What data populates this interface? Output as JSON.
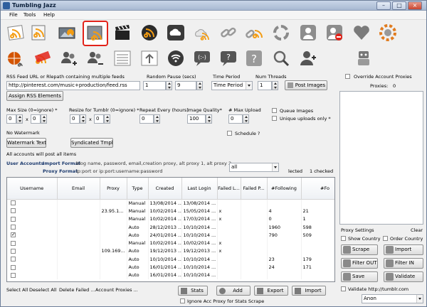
{
  "window": {
    "title": "Tumbling Jazz"
  },
  "menu": [
    "File",
    "Tools",
    "Help"
  ],
  "colors": {
    "accent": "#e2231a",
    "rss": "#f39c12",
    "dark": "#3a3a3a"
  },
  "toolbar_row1": [
    "rss-feed-icon",
    "rss-feed-icon",
    "image-rss-icon",
    "rss-image-selected-icon",
    "clapperboard-icon",
    "rss-circle-icon",
    "cloud-rss-icon",
    "cloud-rss-icon",
    "link-icon",
    "rss-link-icon",
    "refresh-circle-icon",
    "user-portrait-icon",
    "user-remove-icon",
    "heart-icon",
    "rss-settings-icon"
  ],
  "toolbar_row2": [
    "globe-rss-icon",
    "rss-cancel-icon",
    "add-users-icon",
    "users-remove-icon",
    "list-icon",
    "upload-icon",
    "wifi-rss-icon",
    "chat-icon",
    "help-chat-icon",
    "help-icon",
    "magnifier-icon",
    "add-person-icon",
    "robot-icon"
  ],
  "form": {
    "rss_label": "RSS Feed URL or Rlepath containing multiple feeds",
    "rss_value": "http://pinterest.com/music+production/feed.rss",
    "pause_label": "Random Pause (secs)",
    "pause_min": "1",
    "pause_max": "9",
    "period_label": "Time Period",
    "period_value": "Time Period",
    "threads_label": "Num Threads",
    "threads_value": "1",
    "post_images": "Post Images",
    "assign_rss": "Assign RSS Elements",
    "maxsize_label": "Max Size (0=ignore) *",
    "maxsize_w": "0",
    "maxsize_x": "x",
    "maxsize_h": "0",
    "resize_label": "Resize for Tumblr (0=ignore) *",
    "resize_w": "0",
    "resize_x": "x",
    "resize_h": "0",
    "repeat_label": "Repeat Every (hours)",
    "repeat_value": "0",
    "quality_label": "Image Quality*",
    "quality_value": "100",
    "maxupload_label": "# Max Upload",
    "maxupload_value": "0",
    "queue_images": "Queue Images",
    "unique_uploads": "Unique uploads only *",
    "schedule": "Schedule ?",
    "no_watermark": "No Watermark",
    "watermark_btn": "Watermark Text",
    "syndicated_btn": "Syndicated Tmpl",
    "all_accounts": "All accounts will post all items",
    "user_accounts": "User Accounts",
    "import_format_label": "Import Format",
    "import_format_value": "blog name, password, email,creation proxy, alt proxy 1, alt proxy 2, ...",
    "proxy_format_label": "Proxy Format",
    "proxy_format_value": "ip:port  or  ip:port:username:password",
    "filter_value": "all",
    "selected": "lected",
    "checked": "1 checked"
  },
  "grid": {
    "columns": [
      "Username",
      "Email",
      "Proxy",
      "Type",
      "Created",
      "Last Login",
      "Failed L...",
      "Failed P...",
      "#Following",
      "#Fo"
    ],
    "rows": [
      {
        "checked": false,
        "cells": [
          "",
          "",
          "",
          "Manual",
          "13/08/2014 ...",
          "13/08/2014 ...",
          "",
          "",
          "",
          ""
        ]
      },
      {
        "checked": false,
        "cells": [
          "",
          "",
          "23.95.1...",
          "Manual",
          "10/02/2014 ...",
          "15/05/2014 ...",
          "x",
          "",
          "4",
          "21"
        ]
      },
      {
        "checked": false,
        "cells": [
          "",
          "",
          "",
          "Manual",
          "10/02/2014 ...",
          "17/03/2014 ...",
          "x",
          "",
          "0",
          "1"
        ]
      },
      {
        "checked": false,
        "cells": [
          "",
          "",
          "",
          "Auto",
          "28/12/2013 ...",
          "10/10/2014 ...",
          "",
          "",
          "1960",
          "598"
        ]
      },
      {
        "checked": true,
        "cells": [
          "",
          "",
          "",
          "Auto",
          "24/01/2014 ...",
          "10/10/2014 ...",
          "",
          "",
          "790",
          "509"
        ]
      },
      {
        "checked": false,
        "cells": [
          "",
          "",
          "",
          "Manual",
          "10/02/2014 ...",
          "10/02/2014 ...",
          "x",
          "",
          "",
          ""
        ]
      },
      {
        "checked": false,
        "cells": [
          "",
          "",
          "109.169...",
          "Auto",
          "19/12/2013 ...",
          "19/12/2013 ...",
          "x",
          "",
          "",
          ""
        ]
      },
      {
        "checked": false,
        "cells": [
          "",
          "",
          "",
          "Auto",
          "10/10/2014 ...",
          "10/10/2014 ...",
          "",
          "",
          "23",
          "179"
        ]
      },
      {
        "checked": false,
        "cells": [
          "",
          "",
          "",
          "Auto",
          "16/01/2014 ...",
          "10/10/2014 ...",
          "",
          "",
          "24",
          "171"
        ]
      },
      {
        "checked": false,
        "cells": [
          "",
          "",
          "",
          "Auto",
          "16/01/2014 ...",
          "10/10/2014 ...",
          "",
          "",
          "",
          ""
        ]
      }
    ]
  },
  "bottom": {
    "select_all": "Select All",
    "deselect_all": "Deselect All",
    "delete_failed": "Delete Failed ...",
    "account_proxies": "Account Proxies ...",
    "stats": "Stats",
    "add": "Add",
    "export": "Export",
    "import": "Import",
    "ignore_proxy": "Ignore Acc Proxy for Stats Scrape"
  },
  "right": {
    "override": "Override Account Proxies",
    "proxies_label": "Proxies:",
    "proxies_count": "0",
    "proxy_settings": "Proxy Settings",
    "clear": "Clear",
    "show_country": "Show Country",
    "order_country": "Order Country",
    "scrape": "Scrape",
    "import": "Import",
    "filter_out": "Filter OUT",
    "filter_in": "Filter IN",
    "save": "Save",
    "validate": "Validate",
    "validate_url": "Validate http://tumblr.com",
    "anon": "Anon"
  }
}
